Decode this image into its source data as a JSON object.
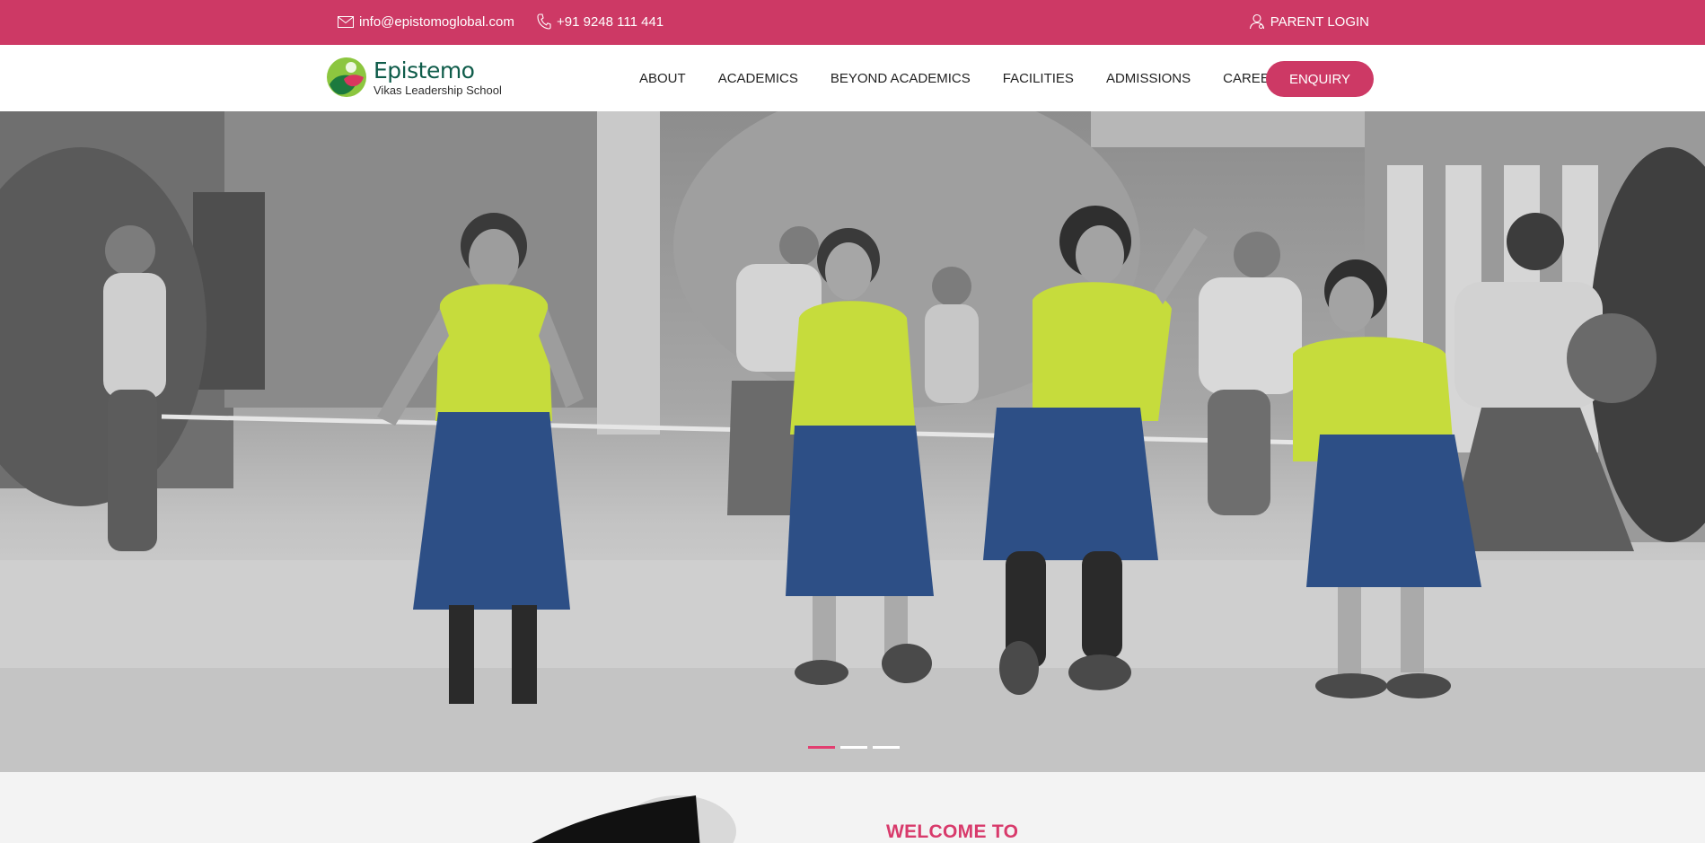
{
  "topbar": {
    "email": "info@epistomoglobal.com",
    "phone": "+91 9248 111 441",
    "parent_login": "PARENT LOGIN",
    "icons": [
      "mail-icon",
      "phone-icon",
      "user-icon"
    ],
    "background_color": "#cd3965"
  },
  "logo": {
    "name": "Epistemo",
    "subtitle": "Vikas Leadership School"
  },
  "nav": {
    "items": [
      "ABOUT",
      "ACADEMICS",
      "BEYOND ACADEMICS",
      "FACILITIES",
      "ADMISSIONS",
      "CAREERS"
    ],
    "enquiry": "ENQUIRY"
  },
  "hero": {
    "slides_total": 3,
    "active_slide": 1
  },
  "welcome": {
    "title": "WELCOME TO"
  },
  "colors": {
    "accent": "#cd3965",
    "active_dot": "#e23e70",
    "logo_green": "#0f5c4a",
    "uniform_shirt": "#c6dc3c",
    "uniform_skirt": "#2d4f86"
  }
}
